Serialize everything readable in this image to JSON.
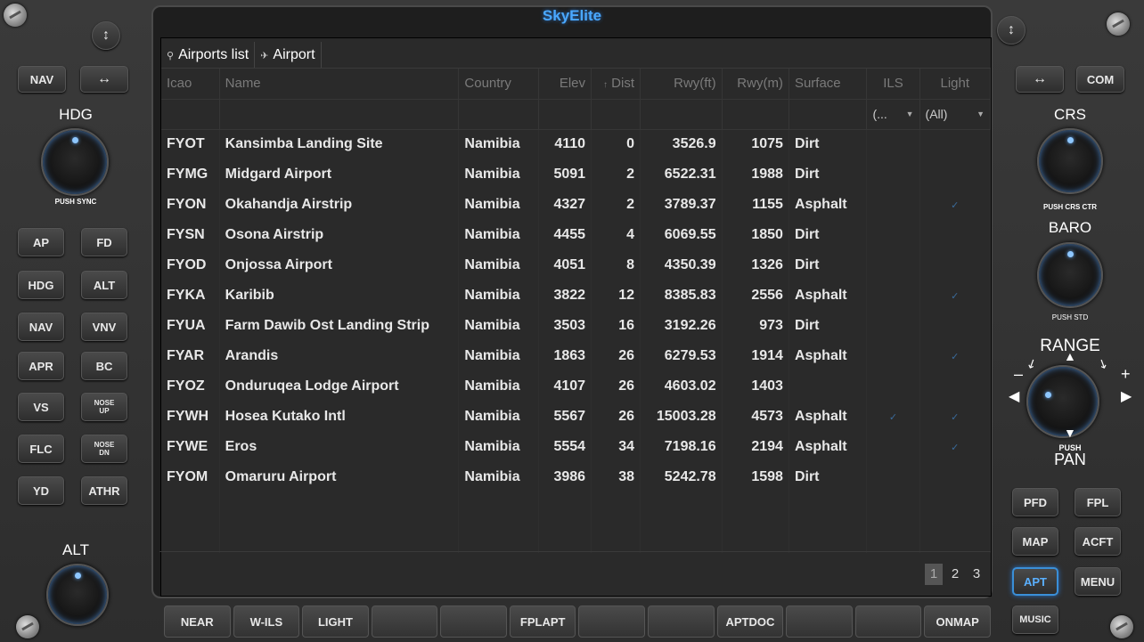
{
  "app": {
    "title": "SkyElite"
  },
  "left_panel": {
    "nav": "NAV",
    "hdg_label": "HDG",
    "push_sync": "PUSH SYNC",
    "alt_label": "ALT",
    "buttons": [
      [
        "AP",
        "FD"
      ],
      [
        "HDG",
        "ALT"
      ],
      [
        "NAV",
        "VNV"
      ],
      [
        "APR",
        "BC"
      ],
      [
        "VS",
        "NOSE UP"
      ],
      [
        "FLC",
        "NOSE DN"
      ],
      [
        "YD",
        "ATHR"
      ]
    ]
  },
  "right_panel": {
    "com": "COM",
    "crs_label": "CRS",
    "push_crs_ctr": "PUSH CRS CTR",
    "baro_label": "BARO",
    "push_std": "PUSH STD",
    "range_label": "RANGE",
    "push": "PUSH",
    "pan": "PAN",
    "minus": "–",
    "plus": "+",
    "buttons": [
      [
        "PFD",
        "FPL"
      ],
      [
        "MAP",
        "ACFT"
      ],
      [
        "APT",
        "MENU"
      ],
      [
        "MUSIC"
      ]
    ],
    "active_button": "APT"
  },
  "tabs": [
    {
      "icon": "search-icon",
      "label": "Airports list"
    },
    {
      "icon": "airplane-icon",
      "label": "Airport"
    }
  ],
  "table": {
    "columns": [
      "Icao",
      "Name",
      "Country",
      "Elev",
      "Dist",
      "Rwy(ft)",
      "Rwy(m)",
      "Surface",
      "ILS",
      "Light"
    ],
    "sort_indicator": "↑",
    "filters": {
      "ils": "(...",
      "light": "(All)"
    },
    "rows": [
      {
        "icao": "FYOT",
        "name": "Kansimba Landing Site",
        "country": "Namibia",
        "elev": "4110",
        "dist": "0",
        "rwy_ft": "3526.9",
        "rwy_m": "1075",
        "surface": "Dirt",
        "ils": false,
        "light": false
      },
      {
        "icao": "FYMG",
        "name": "Midgard Airport",
        "country": "Namibia",
        "elev": "5091",
        "dist": "2",
        "rwy_ft": "6522.31",
        "rwy_m": "1988",
        "surface": "Dirt",
        "ils": false,
        "light": false
      },
      {
        "icao": "FYON",
        "name": "Okahandja Airstrip",
        "country": "Namibia",
        "elev": "4327",
        "dist": "2",
        "rwy_ft": "3789.37",
        "rwy_m": "1155",
        "surface": "Asphalt",
        "ils": false,
        "light": true
      },
      {
        "icao": "FYSN",
        "name": "Osona Airstrip",
        "country": "Namibia",
        "elev": "4455",
        "dist": "4",
        "rwy_ft": "6069.55",
        "rwy_m": "1850",
        "surface": "Dirt",
        "ils": false,
        "light": false
      },
      {
        "icao": "FYOD",
        "name": "Onjossa Airport",
        "country": "Namibia",
        "elev": "4051",
        "dist": "8",
        "rwy_ft": "4350.39",
        "rwy_m": "1326",
        "surface": "Dirt",
        "ils": false,
        "light": false
      },
      {
        "icao": "FYKA",
        "name": "Karibib",
        "country": "Namibia",
        "elev": "3822",
        "dist": "12",
        "rwy_ft": "8385.83",
        "rwy_m": "2556",
        "surface": "Asphalt",
        "ils": false,
        "light": true
      },
      {
        "icao": "FYUA",
        "name": "Farm Dawib Ost Landing Strip",
        "country": "Namibia",
        "elev": "3503",
        "dist": "16",
        "rwy_ft": "3192.26",
        "rwy_m": "973",
        "surface": "Dirt",
        "ils": false,
        "light": false
      },
      {
        "icao": "FYAR",
        "name": "Arandis",
        "country": "Namibia",
        "elev": "1863",
        "dist": "26",
        "rwy_ft": "6279.53",
        "rwy_m": "1914",
        "surface": "Asphalt",
        "ils": false,
        "light": true
      },
      {
        "icao": "FYOZ",
        "name": "Onduruqea Lodge Airport",
        "country": "Namibia",
        "elev": "4107",
        "dist": "26",
        "rwy_ft": "4603.02",
        "rwy_m": "1403",
        "surface": "",
        "ils": false,
        "light": false
      },
      {
        "icao": "FYWH",
        "name": "Hosea Kutako Intl",
        "country": "Namibia",
        "elev": "5567",
        "dist": "26",
        "rwy_ft": "15003.28",
        "rwy_m": "4573",
        "surface": "Asphalt",
        "ils": true,
        "light": true
      },
      {
        "icao": "FYWE",
        "name": "Eros",
        "country": "Namibia",
        "elev": "5554",
        "dist": "34",
        "rwy_ft": "7198.16",
        "rwy_m": "2194",
        "surface": "Asphalt",
        "ils": false,
        "light": true
      },
      {
        "icao": "FYOM",
        "name": "Omaruru Airport",
        "country": "Namibia",
        "elev": "3986",
        "dist": "38",
        "rwy_ft": "5242.78",
        "rwy_m": "1598",
        "surface": "Dirt",
        "ils": false,
        "light": false
      }
    ]
  },
  "pagination": {
    "pages": [
      "1",
      "2",
      "3"
    ],
    "current": "1"
  },
  "softkeys": [
    "NEAR",
    "W-ILS",
    "LIGHT",
    "",
    "",
    "FPLAPT",
    "",
    "",
    "APTDOC",
    "",
    "",
    "ONMAP"
  ]
}
